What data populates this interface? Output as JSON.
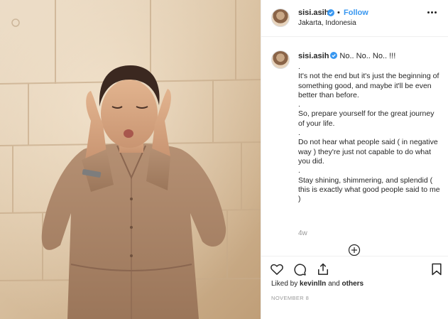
{
  "post": {
    "username": "sisi.asih",
    "follow_separator": "•",
    "follow_label": "Follow",
    "location": "Jakarta, Indonesia",
    "caption_first": "No.. No.. No.. !!!",
    "caption_body": ".\nIt's not the end but it's just the beginning of something good, and maybe it'll be even better than before.\n.\nSo, prepare yourself for the great journey of your life.\n.\nDo not hear what people said ( in negative way ) they're just not capable to do what you did.\n.\nStay shining, shimmering, and splendid ( this is exactly what good people said to me )",
    "time_ago": "4w",
    "likes_prefix": "Liked by",
    "likes_user": "kevinlln",
    "likes_and": "and",
    "likes_others": "others",
    "date": "NOVEMBER 8"
  },
  "icons": {
    "verified": "verified-badge-icon",
    "more": "more-options-icon",
    "load_more": "plus-circle-icon",
    "like": "heart-icon",
    "comment": "comment-icon",
    "share": "share-icon",
    "save": "bookmark-icon"
  },
  "colors": {
    "accent": "#3897f0",
    "text": "#262626",
    "muted": "#999999",
    "border": "#efefef"
  }
}
